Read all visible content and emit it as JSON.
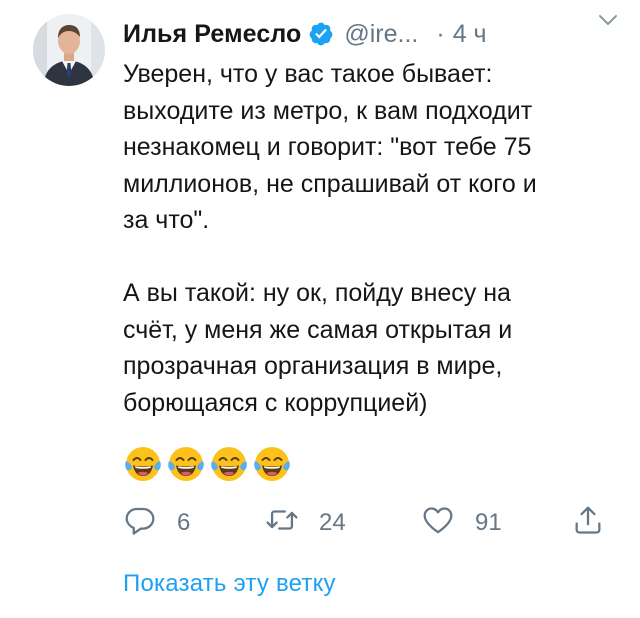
{
  "tweet": {
    "author": {
      "display_name": "Илья Ремесло",
      "handle": "@ire...",
      "verified": true
    },
    "separator": "·",
    "time": "4 ч",
    "paragraphs": [
      "Уверен, что у вас такое бывает:\nвыходите из метро, к вам подходит\nнезнакомец и говорит: \"вот тебе 75\nмиллионов, не спрашивай от кого и\nза что\".",
      "А вы такой: ну ок, пойду внесу на\nсчёт, у меня же самая открытая и\nпрозрачная организация в мире,\nборющаяся с коррупцией)"
    ],
    "emojis": [
      "face-with-tears-of-joy",
      "face-with-tears-of-joy",
      "face-with-tears-of-joy",
      "face-with-tears-of-joy"
    ],
    "actions": {
      "reply_count": "6",
      "retweet_count": "24",
      "like_count": "91"
    },
    "show_thread_label": "Показать эту ветку"
  },
  "colors": {
    "text": "#14171a",
    "muted": "#657786",
    "accent": "#1da1f2",
    "emoji_face": "#fcc21b"
  },
  "icons": {
    "verified": "verified-badge-icon",
    "caret": "chevron-down-icon",
    "reply": "reply-icon",
    "retweet": "retweet-icon",
    "like": "heart-icon",
    "share": "share-icon"
  }
}
